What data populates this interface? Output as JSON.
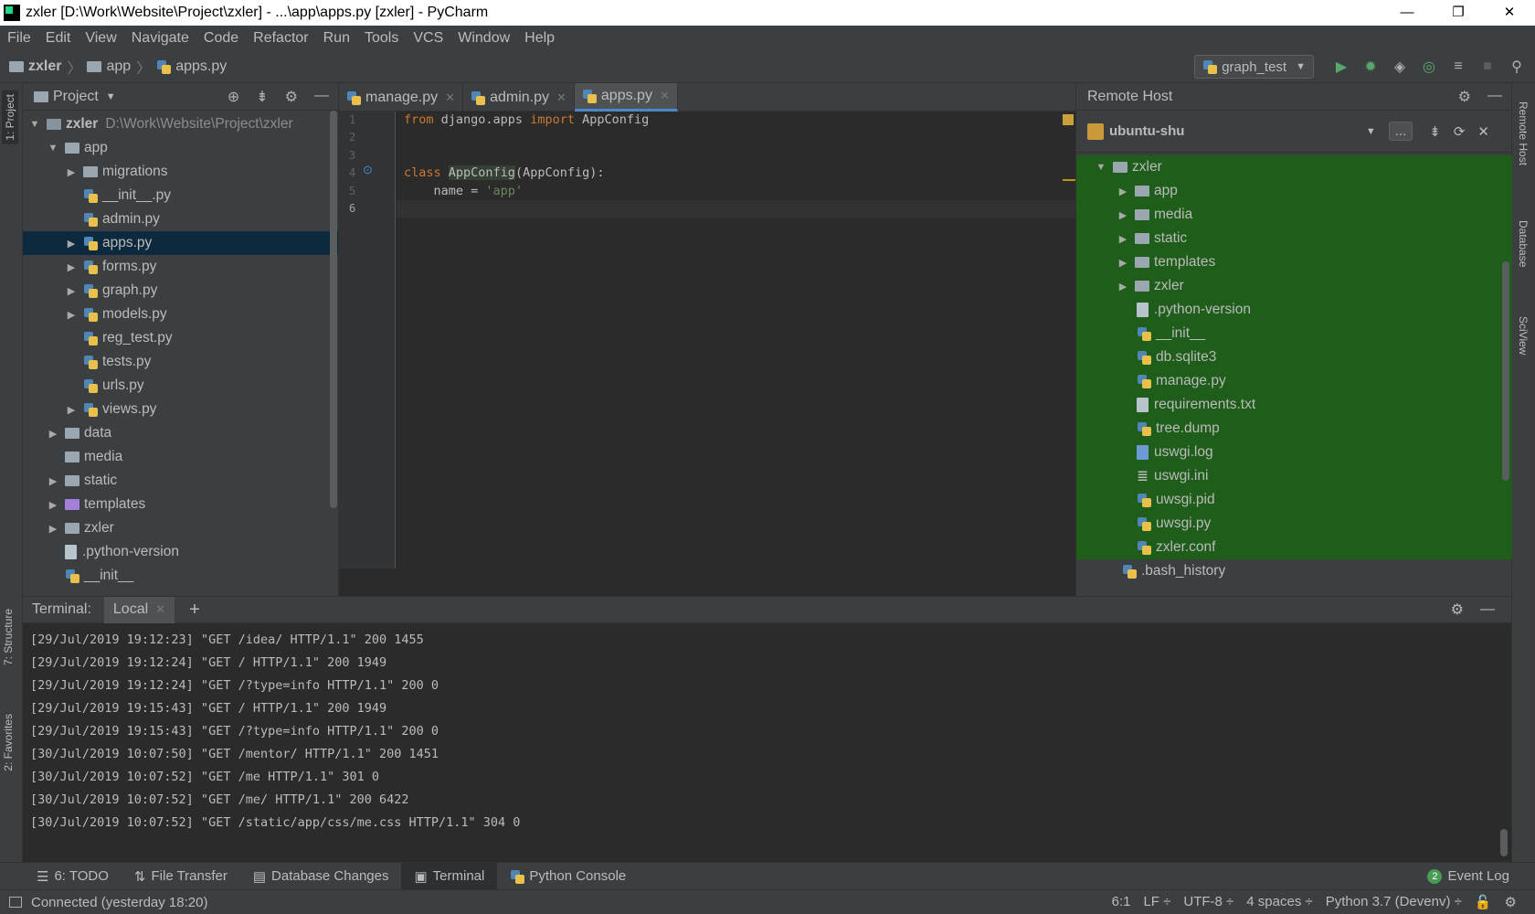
{
  "window": {
    "title": "zxler [D:\\Work\\Website\\Project\\zxler] - ...\\app\\apps.py [zxler] - PyCharm",
    "controls": [
      "—",
      "❐",
      "✕"
    ]
  },
  "menu": [
    "File",
    "Edit",
    "View",
    "Navigate",
    "Code",
    "Refactor",
    "Run",
    "Tools",
    "VCS",
    "Window",
    "Help"
  ],
  "breadcrumb": {
    "root": "zxler",
    "folder": "app",
    "file": "apps.py"
  },
  "run_config": "graph_test",
  "side_tabs": {
    "project": "1: Project",
    "structure": "7: Structure",
    "favorites": "2: Favorites",
    "remote_host": "Remote Host",
    "database": "Database",
    "sciview": "SciView"
  },
  "project_panel": {
    "title": "Project",
    "root": {
      "name": "zxler",
      "path": "D:\\Work\\Website\\Project\\zxler"
    },
    "items": [
      {
        "label": "app"
      },
      {
        "label": "migrations"
      },
      {
        "label": "__init__.py"
      },
      {
        "label": "admin.py"
      },
      {
        "label": "apps.py"
      },
      {
        "label": "forms.py"
      },
      {
        "label": "graph.py"
      },
      {
        "label": "models.py"
      },
      {
        "label": "reg_test.py"
      },
      {
        "label": "tests.py"
      },
      {
        "label": "urls.py"
      },
      {
        "label": "views.py"
      },
      {
        "label": "data"
      },
      {
        "label": "media"
      },
      {
        "label": "static"
      },
      {
        "label": "templates"
      },
      {
        "label": "zxler"
      },
      {
        "label": ".python-version"
      },
      {
        "label": "__init__"
      }
    ]
  },
  "editor": {
    "tabs": [
      "manage.py",
      "admin.py",
      "apps.py"
    ],
    "line_numbers": [
      "1",
      "2",
      "3",
      "4",
      "5",
      "6"
    ],
    "code": {
      "l1_kw1": "from",
      "l1_mod": " django.apps ",
      "l1_kw2": "import",
      "l1_name": " AppConfig",
      "l4_kw": "class",
      "l4_sp": " ",
      "l4_cls": "AppConfig",
      "l4_rest": "(AppConfig):",
      "l5_pre": "    name = ",
      "l5_str": "'app'"
    }
  },
  "remote_host": {
    "title": "Remote Host",
    "server": "ubuntu-shu",
    "more_label": "...",
    "items": [
      {
        "label": "zxler"
      },
      {
        "label": "app"
      },
      {
        "label": "media"
      },
      {
        "label": "static"
      },
      {
        "label": "templates"
      },
      {
        "label": "zxler"
      },
      {
        "label": ".python-version"
      },
      {
        "label": "__init__"
      },
      {
        "label": "db.sqlite3"
      },
      {
        "label": "manage.py"
      },
      {
        "label": "requirements.txt"
      },
      {
        "label": "tree.dump"
      },
      {
        "label": "uswgi.log"
      },
      {
        "label": "uswgi.ini"
      },
      {
        "label": "uwsgi.pid"
      },
      {
        "label": "uwsgi.py"
      },
      {
        "label": "zxler.conf"
      },
      {
        "label": ".bash_history"
      }
    ]
  },
  "terminal": {
    "label": "Terminal:",
    "tab": "Local",
    "lines": [
      "[29/Jul/2019 19:12:23] \"GET /idea/ HTTP/1.1\" 200 1455",
      "[29/Jul/2019 19:12:24] \"GET / HTTP/1.1\" 200 1949",
      "[29/Jul/2019 19:12:24] \"GET /?type=info HTTP/1.1\" 200 0",
      "[29/Jul/2019 19:15:43] \"GET / HTTP/1.1\" 200 1949",
      "[29/Jul/2019 19:15:43] \"GET /?type=info HTTP/1.1\" 200 0",
      "[30/Jul/2019 10:07:50] \"GET /mentor/ HTTP/1.1\" 200 1451",
      "[30/Jul/2019 10:07:52] \"GET /me HTTP/1.1\" 301 0",
      "[30/Jul/2019 10:07:52] \"GET /me/ HTTP/1.1\" 200 6422",
      "[30/Jul/2019 10:07:52] \"GET /static/app/css/me.css HTTP/1.1\" 304 0"
    ]
  },
  "bottom_tabs": {
    "todo": "6: TODO",
    "file_transfer": "File Transfer",
    "db_changes": "Database Changes",
    "terminal": "Terminal",
    "python_console": "Python Console",
    "event_log": "Event Log",
    "event_count": "2"
  },
  "status": {
    "message": "Connected (yesterday 18:20)",
    "position": "6:1",
    "line_sep": "LF ÷",
    "encoding": "UTF-8 ÷",
    "indent": "4 spaces ÷",
    "interpreter": "Python 3.7 (Devenv) ÷"
  },
  "colors": {
    "accent": "#4a88c7",
    "remote_highlight": "#1e5d1a",
    "keyword": "#cc7832",
    "string": "#6a8759"
  }
}
